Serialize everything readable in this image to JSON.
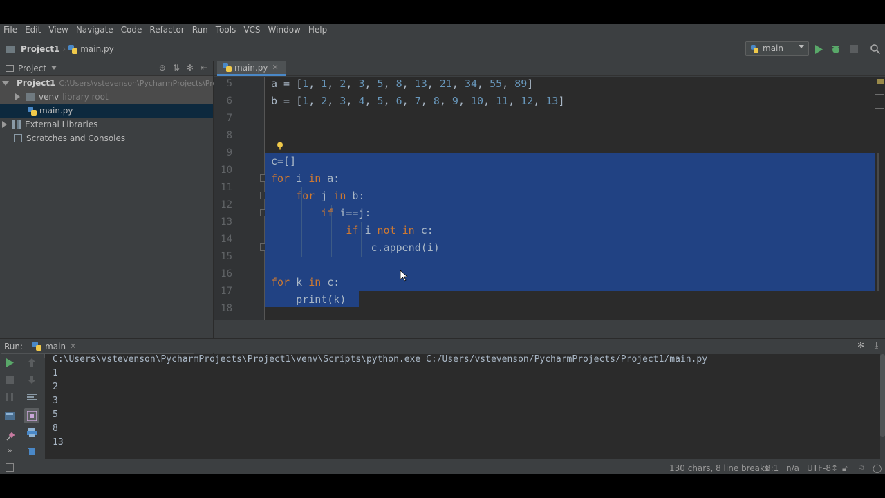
{
  "menu": [
    "File",
    "Edit",
    "View",
    "Navigate",
    "Code",
    "Refactor",
    "Run",
    "Tools",
    "VCS",
    "Window",
    "Help"
  ],
  "navbar": {
    "project": "Project1",
    "file": "main.py",
    "run_config": "main"
  },
  "project_pane": {
    "title": "Project",
    "tree": {
      "root_name": "Project1",
      "root_path": "C:\\Users\\vstevenson\\PycharmProjects\\Pro",
      "venv": "venv",
      "venv_note": "library root",
      "file": "main.py",
      "external": "External Libraries",
      "scratches": "Scratches and Consoles"
    }
  },
  "editor": {
    "tab": "main.py",
    "line_numbers": [
      "5",
      "6",
      "7",
      "8",
      "9",
      "10",
      "11",
      "12",
      "13",
      "14",
      "15",
      "16",
      "17",
      "18"
    ],
    "lines": {
      "l5": {
        "var": "a = [",
        "vals": [
          "1",
          "1",
          "2",
          "3",
          "5",
          "8",
          "13",
          "21",
          "34",
          "55",
          "89"
        ],
        "end": "]"
      },
      "l6": {
        "var": "b = [",
        "vals": [
          "1",
          "2",
          "3",
          "4",
          "5",
          "6",
          "7",
          "8",
          "9",
          "10",
          "11",
          "12",
          "13"
        ],
        "end": "]"
      },
      "l8": "c=[]",
      "l9": {
        "kw1": "for",
        "mid1": " i ",
        "kw2": "in",
        "rest": " a:"
      },
      "l10": {
        "indent": "    ",
        "kw1": "for",
        "mid1": " j ",
        "kw2": "in",
        "rest": " b:"
      },
      "l11": {
        "indent": "        ",
        "kw1": "if",
        "rest": " i==j:"
      },
      "l12": {
        "indent": "            ",
        "kw1": "if",
        "mid1": " i ",
        "kw2": "not in",
        "rest": " c:"
      },
      "l13": "                c.append(i)",
      "l15": {
        "kw1": "for",
        "mid1": " k ",
        "kw2": "in",
        "rest": " c:"
      },
      "l16": "    print(k)"
    }
  },
  "run": {
    "label": "Run:",
    "tab": "main",
    "command": "C:\\Users\\vstevenson\\PycharmProjects\\Project1\\venv\\Scripts\\python.exe C:/Users/vstevenson/PycharmProjects/Project1/main.py",
    "output": [
      "1",
      "2",
      "3",
      "5",
      "8",
      "13"
    ]
  },
  "status": {
    "selection": "130 chars, 8 line breaks",
    "position": "8:1",
    "line_sep": "n/a",
    "encoding": "UTF-8↕"
  },
  "colors": {
    "bg": "#3c3f41",
    "editor_bg": "#2b2b2b",
    "selection": "#214283",
    "keyword": "#cc7832",
    "number": "#6897bb",
    "text": "#a9b7c6"
  }
}
